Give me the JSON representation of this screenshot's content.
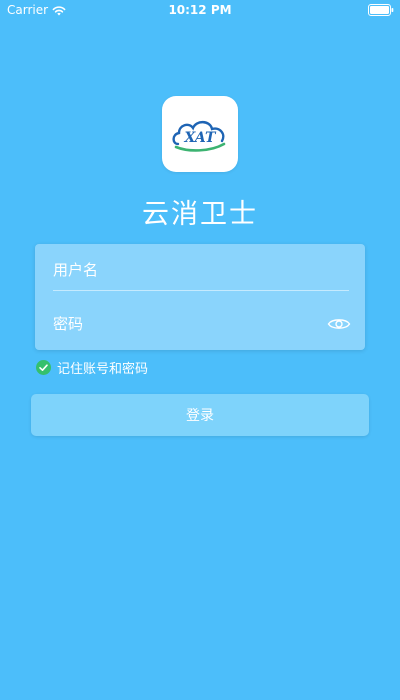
{
  "status_bar": {
    "carrier": "Carrier",
    "time": "10:12 PM"
  },
  "app": {
    "title": "云消卫士",
    "logo_text": "XAT"
  },
  "login": {
    "username_placeholder": "用户名",
    "password_placeholder": "密码",
    "remember_label": "记住账号和密码",
    "remember_checked": true,
    "submit_label": "登录"
  },
  "icons": {
    "wifi": "wifi-icon",
    "battery": "battery-icon",
    "eye": "eye-icon",
    "check": "check-circle-icon"
  },
  "colors": {
    "background": "#4cbefa",
    "button": "#7ed3fb",
    "check": "#35c06d",
    "logo_blue": "#1e64b4",
    "logo_green": "#3cb371"
  }
}
